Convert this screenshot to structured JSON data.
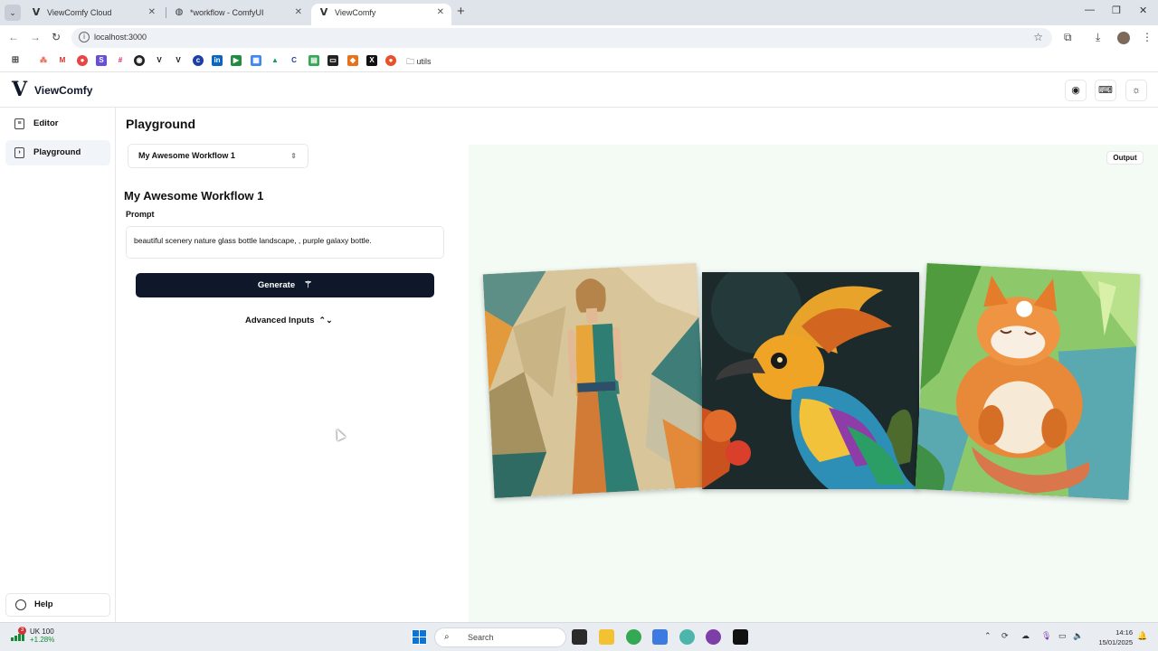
{
  "browser": {
    "tabs": [
      {
        "label": "ViewComfy Cloud",
        "favicon": "V"
      },
      {
        "label": "*workflow - ComfyUI",
        "favicon": "globe-icon"
      },
      {
        "label": "ViewComfy",
        "favicon": "V",
        "active": true
      }
    ],
    "url": "localhost:3000",
    "bookmark_folder": "utils"
  },
  "app": {
    "logo_glyph": "V",
    "brand": "ViewComfy"
  },
  "sidebar": {
    "items": [
      {
        "label": "Editor",
        "icon": "file-icon"
      },
      {
        "label": "Playground",
        "icon": "terminal-icon",
        "active": true
      }
    ],
    "help": "Help"
  },
  "main": {
    "title": "Playground",
    "workflow_select": "My Awesome Workflow 1",
    "workflow_title": "My Awesome Workflow 1",
    "prompt_label": "Prompt",
    "prompt_value": "beautiful scenery nature glass bottle landscape, , purple galaxy bottle.",
    "generate_label": "Generate",
    "advanced_label": "Advanced Inputs"
  },
  "output": {
    "badge": "Output",
    "images": [
      "woman-fashion-geometric-image",
      "colorful-bird-image",
      "sleeping-fox-image"
    ]
  },
  "taskbar": {
    "weather_title": "UK 100",
    "weather_change": "+1.28%",
    "notif_count": "3",
    "search_placeholder": "Search",
    "time": "14:16",
    "date": "15/01/2025"
  },
  "colors": {
    "primary": "#0f172a",
    "output_bg": "#f4fbf5",
    "sidebar_active": "#f1f5f9"
  }
}
